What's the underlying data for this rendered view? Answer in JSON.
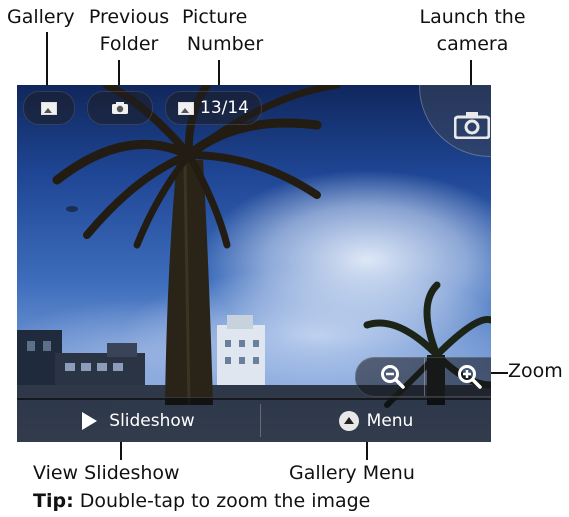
{
  "annotations": {
    "gallery": "Gallery",
    "previous_folder_1": "Previous",
    "previous_folder_2": "Folder",
    "picture_number_1": "Picture",
    "picture_number_2": "Number",
    "launch_camera_1": "Launch the",
    "launch_camera_2": "camera",
    "zoom": "Zoom",
    "view_slideshow": "View Slideshow",
    "gallery_menu": "Gallery Menu"
  },
  "tip": {
    "label": "Tip:",
    "text": " Double-tap to zoom the image"
  },
  "screen": {
    "picture_count": "13/14",
    "slideshow_label": "Slideshow",
    "menu_label": "Menu"
  },
  "icons": {
    "gallery": "picture-icon",
    "previous_folder": "camera-icon",
    "picture_number": "picture-icon",
    "launch_camera": "camera-icon",
    "zoom_out": "zoom-out-icon",
    "zoom_in": "zoom-in-icon",
    "slideshow": "play-icon",
    "menu": "menu-up-icon"
  }
}
